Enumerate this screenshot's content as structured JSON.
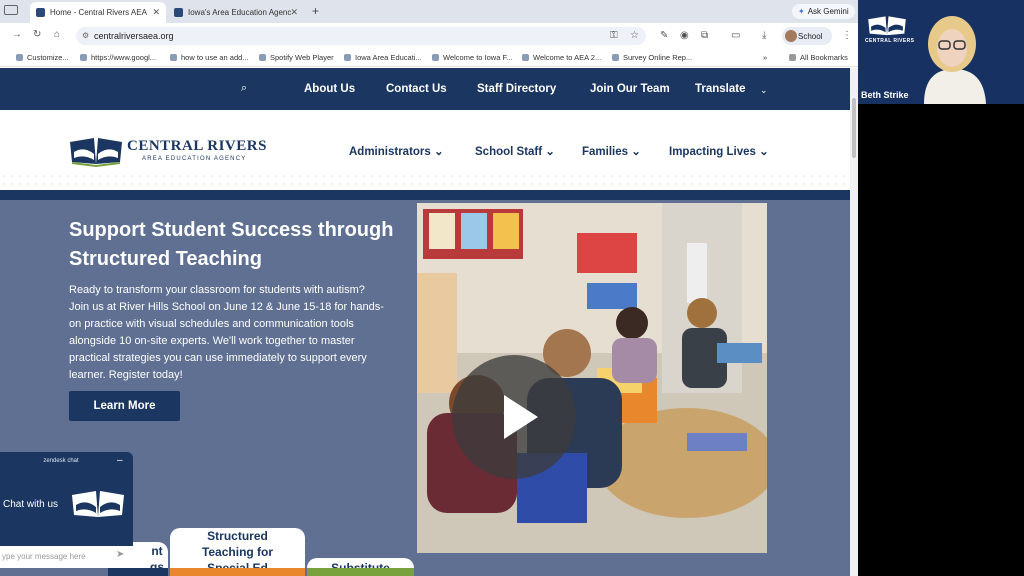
{
  "browser": {
    "tabs": [
      {
        "title": "Home - Central Rivers AEA",
        "active": true
      },
      {
        "title": "Iowa's Area Education Agenc",
        "active": false
      }
    ],
    "new_tab": "+",
    "gemini": "Ask Gemini",
    "url": "centralriversaea.org",
    "profile": "School",
    "bookmarks": [
      "Customize...",
      "https://www.googl...",
      "how to use an add...",
      "Spotify Web Player",
      "Iowa Area Educati...",
      "Welcome to Iowa F...",
      "Welcome to AEA 2...",
      "Survey Online Rep..."
    ],
    "all_bookmarks": "All Bookmarks",
    "overflow": "»"
  },
  "site": {
    "utility_nav": [
      "About Us",
      "Contact Us",
      "Staff Directory",
      "Join Our Team",
      "Translate"
    ],
    "logo": {
      "title": "CENTRAL RIVERS",
      "subtitle": "AREA EDUCATION AGENCY"
    },
    "main_nav": [
      "Administrators",
      "School Staff",
      "Families",
      "Impacting Lives"
    ],
    "hero": {
      "title": "Support Student Success through Structured Teaching",
      "body": "Ready to transform your classroom for students with autism? Join us at River Hills School on June 12 & June 15-18 for hands-on practice with visual schedules and communication tools alongside 10 on-site experts. We'll work together to master practical strategies you can use immediately to support every learner. Register today!",
      "button": "Learn More"
    },
    "cards": [
      {
        "label": "nt\ngs",
        "stripe": "#1b3660"
      },
      {
        "label": "Structured Teaching for Special Ed",
        "stripe": "#e8872c"
      },
      {
        "label": "Substitute Authoriza...",
        "stripe": "#7aa23c"
      }
    ]
  },
  "zendesk": {
    "header": "zendesk chat",
    "minimize": "–",
    "prompt": "Chat with us",
    "placeholder": "ype your message here"
  },
  "video_call": {
    "participant": "Beth Strike",
    "logo_text": "CENTRAL RIVERS"
  },
  "colors": {
    "navy": "#1b3660",
    "hero_bg": "#5f7092",
    "orange": "#e8872c",
    "green": "#7aa23c"
  }
}
